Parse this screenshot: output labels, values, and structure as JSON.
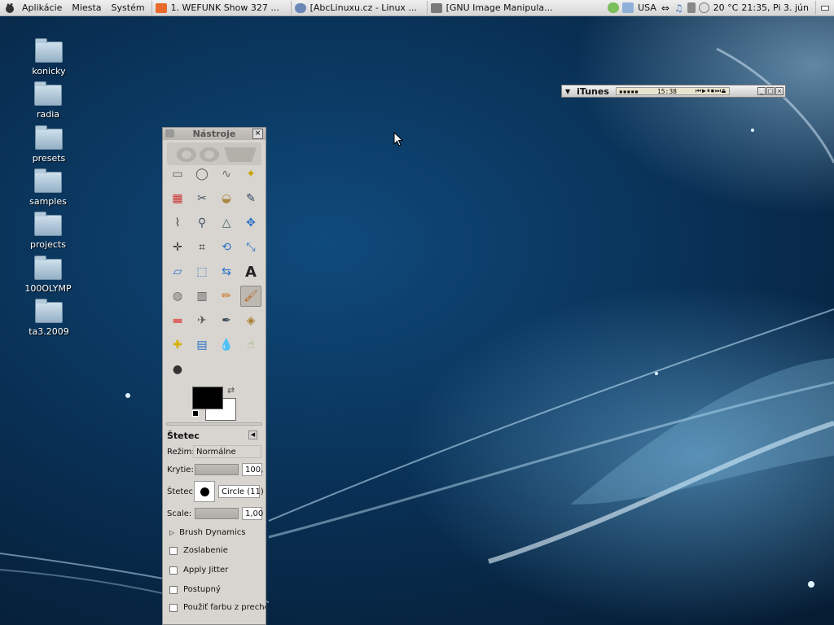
{
  "panel": {
    "menus": [
      "Aplikácie",
      "Miesta",
      "Systém"
    ],
    "tasks": [
      {
        "label": "1. WEFUNK Show 327 ...",
        "color": "#e86a2a"
      },
      {
        "label": "[AbcLinuxu.cz - Linux ...",
        "color": "#6b87b5"
      },
      {
        "label": "[GNU Image Manipula...",
        "color": "#7a7a7a"
      }
    ],
    "keyboard_layout": "USA",
    "weather": "20 °C",
    "clock": "21:35, Pi  3. jún"
  },
  "desktop_icons": [
    "konicky",
    "radia",
    "presets",
    "samples",
    "projects",
    "100OLYMP",
    "ta3.2009"
  ],
  "itunes": {
    "title": "iTunes",
    "time": "15:38"
  },
  "toolbox": {
    "title": "Nástroje",
    "tools": [
      "rect-select-icon",
      "ellipse-select-icon",
      "free-select-icon",
      "fuzzy-select-icon",
      "color-select-icon",
      "scissors-icon",
      "foreground-select-icon",
      "paths-icon",
      "color-picker-icon",
      "zoom-icon",
      "measure-icon",
      "move-icon",
      "align-icon",
      "crop-icon",
      "rotate-icon",
      "scale-icon",
      "shear-icon",
      "perspective-icon",
      "flip-icon",
      "text-icon",
      "bucket-fill-icon",
      "blend-icon",
      "pencil-icon",
      "paintbrush-icon",
      "eraser-icon",
      "airbrush-icon",
      "ink-icon",
      "clone-icon",
      "heal-icon",
      "perspective-clone-icon",
      "blur-icon",
      "smudge-icon",
      "dodge-burn-icon"
    ],
    "active_tool_index": 23,
    "fg_color": "#000000",
    "bg_color": "#ffffff"
  },
  "tool_options": {
    "title": "Štetec",
    "mode_label": "Režim:",
    "mode_value": "Normálne",
    "opacity_label": "Krytie:",
    "opacity_value": "100,",
    "brush_label": "Štetec:",
    "brush_value": "Circle (11)",
    "scale_label": "Scale:",
    "scale_value": "1,00",
    "dynamics_label": "Brush Dynamics",
    "checkboxes": [
      "Zoslabenie",
      "Apply Jitter",
      "Postupný",
      "Použiť farbu z prechod"
    ]
  }
}
